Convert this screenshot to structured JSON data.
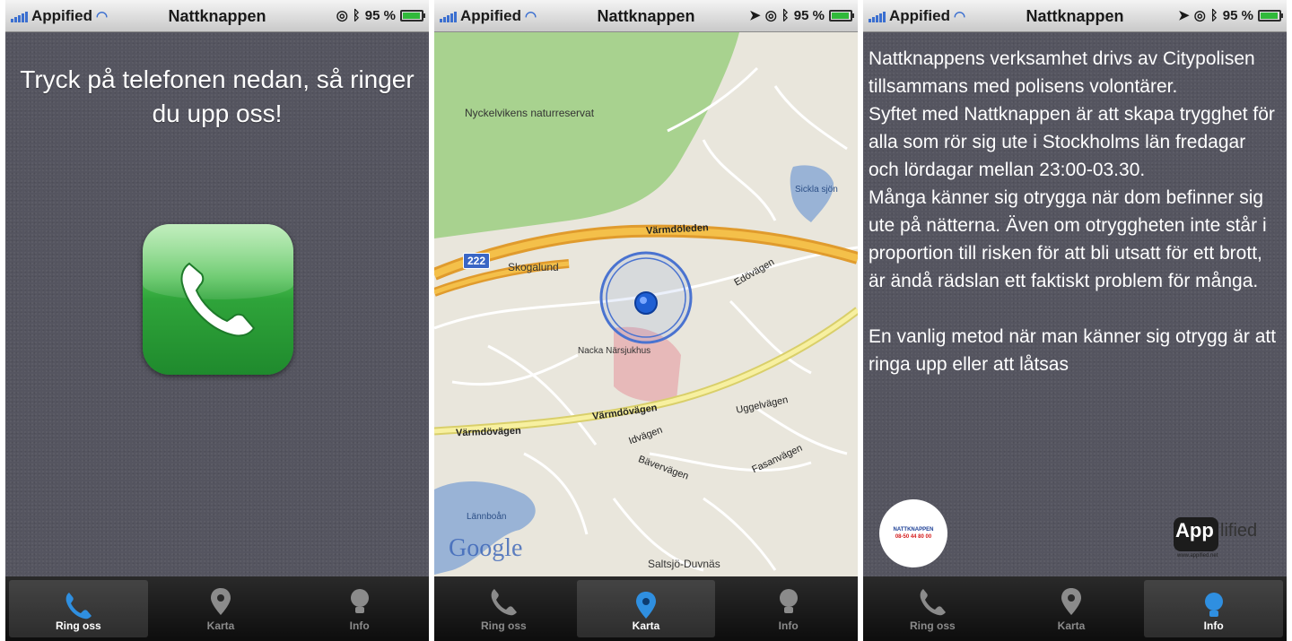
{
  "status_bar": {
    "carrier": "Appified",
    "title": "Nattknappen",
    "battery": "95 %"
  },
  "tabs": [
    {
      "label": "Ring oss",
      "icon": "phone-icon"
    },
    {
      "label": "Karta",
      "icon": "map-pin-icon"
    },
    {
      "label": "Info",
      "icon": "lightbulb-icon"
    }
  ],
  "ring_screen": {
    "headline": "Tryck på telefonen nedan, så ringer du upp oss!"
  },
  "map_screen": {
    "places": [
      "Nyckelvikens naturreservat",
      "Skogalund",
      "Nacka Närsjukhus",
      "Sickla sjön",
      "Saltsjö-Duvnäs",
      "Lännboån"
    ],
    "roads": [
      "Värmdöleden",
      "Värmdövägen",
      "Värmdövägen",
      "Edövägen",
      "Bävervägen",
      "Uggelvägen",
      "Idvägen",
      "Fasanvägen"
    ],
    "route_shield": "222",
    "attribution": "Google"
  },
  "info_screen": {
    "paragraphs": [
      "Nattknappens verksamhet drivs av Citypolisen tillsammans med polisens volontärer.",
      "Syftet med Nattknappen är att skapa trygghet för alla som rör sig ute i Stockholms län fredagar och lördagar mellan 23:00-03.30.",
      "Många känner sig otrygga när dom befinner sig ute på nätterna. Även om otryggheten inte står i proportion till risken för att bli utsatt för ett brott, är ändå rädslan ett faktiskt problem för många.",
      "En vanlig metod när man känner sig otrygg är att ringa upp eller att låtsas"
    ],
    "badge": {
      "name": "NATTKNAPPEN",
      "phone": "08-50 44 80 00"
    },
    "logo": {
      "prefix": "App",
      "suffix": "lified",
      "url": "www.appified.net"
    }
  },
  "colors": {
    "screen_bg": "#555560",
    "call_green": "#2fa43a",
    "active_tab_icon": "#2f8fe0",
    "status_text": "#1a1a1a"
  }
}
